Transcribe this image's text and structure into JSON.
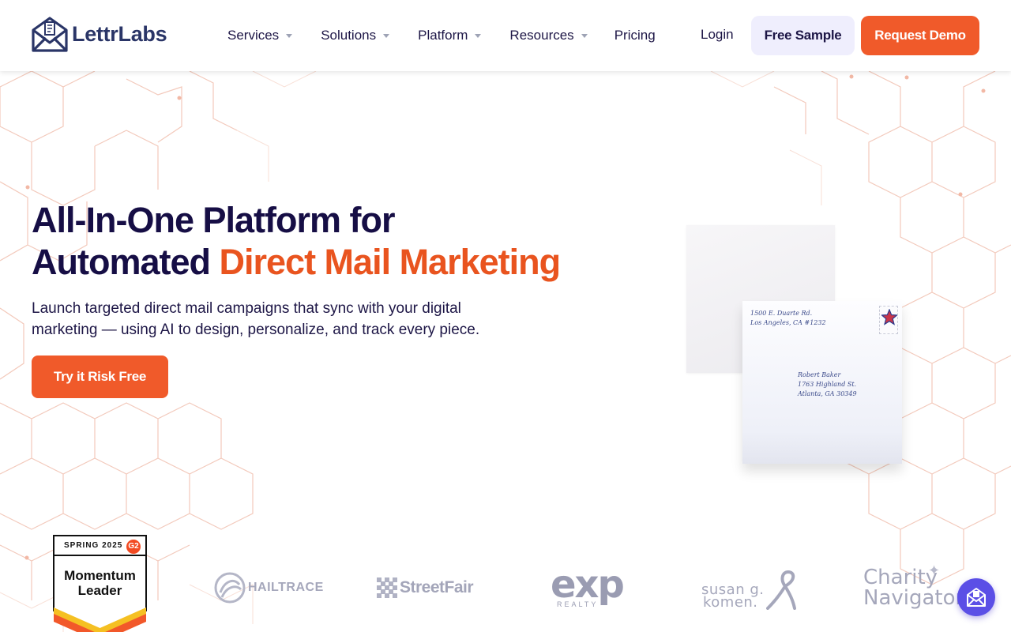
{
  "brand": {
    "name": "LettrLabs",
    "primary_color": "#2a3567",
    "accent_color": "#f05a2a"
  },
  "nav": {
    "items": [
      {
        "label": "Services",
        "has_dropdown": true
      },
      {
        "label": "Solutions",
        "has_dropdown": true
      },
      {
        "label": "Platform",
        "has_dropdown": true
      },
      {
        "label": "Resources",
        "has_dropdown": true
      },
      {
        "label": "Pricing",
        "has_dropdown": false
      }
    ],
    "login_label": "Login",
    "free_sample_label": "Free Sample",
    "request_demo_label": "Request Demo"
  },
  "hero": {
    "title_line1": "All-In-One Platform for",
    "title_line2_plain": "Automated ",
    "title_line2_accent": "Direct Mail Marketing",
    "subtitle_line1": "Launch targeted direct mail campaigns that sync with your digital",
    "subtitle_line2": "marketing — using AI to design, personalize, and track every piece.",
    "cta_label": "Try it Risk Free"
  },
  "envelope": {
    "return_line1": "1500 E. Duarte Rd.",
    "return_line2": "Los Angeles, CA #1232",
    "to_line1": "Robert Baker",
    "to_line2": "1763 Highland St.",
    "to_line3": "Atlanta, GA 30349"
  },
  "badge": {
    "season": "SPRING 2025",
    "g2": "G2",
    "title_line1": "Momentum",
    "title_line2": "Leader"
  },
  "logos": {
    "hailtrace": "HAILTRACE",
    "streetfair": "StreetFair",
    "exp": "exp",
    "exp_sub": "REALTY",
    "komen_line1": "susan g.",
    "komen_line2": "komen.",
    "charity_line1": "Charity",
    "charity_line2": "Navigator"
  },
  "icons": {
    "chat": "mail-chat-icon",
    "logo": "envelope-logo-icon"
  }
}
